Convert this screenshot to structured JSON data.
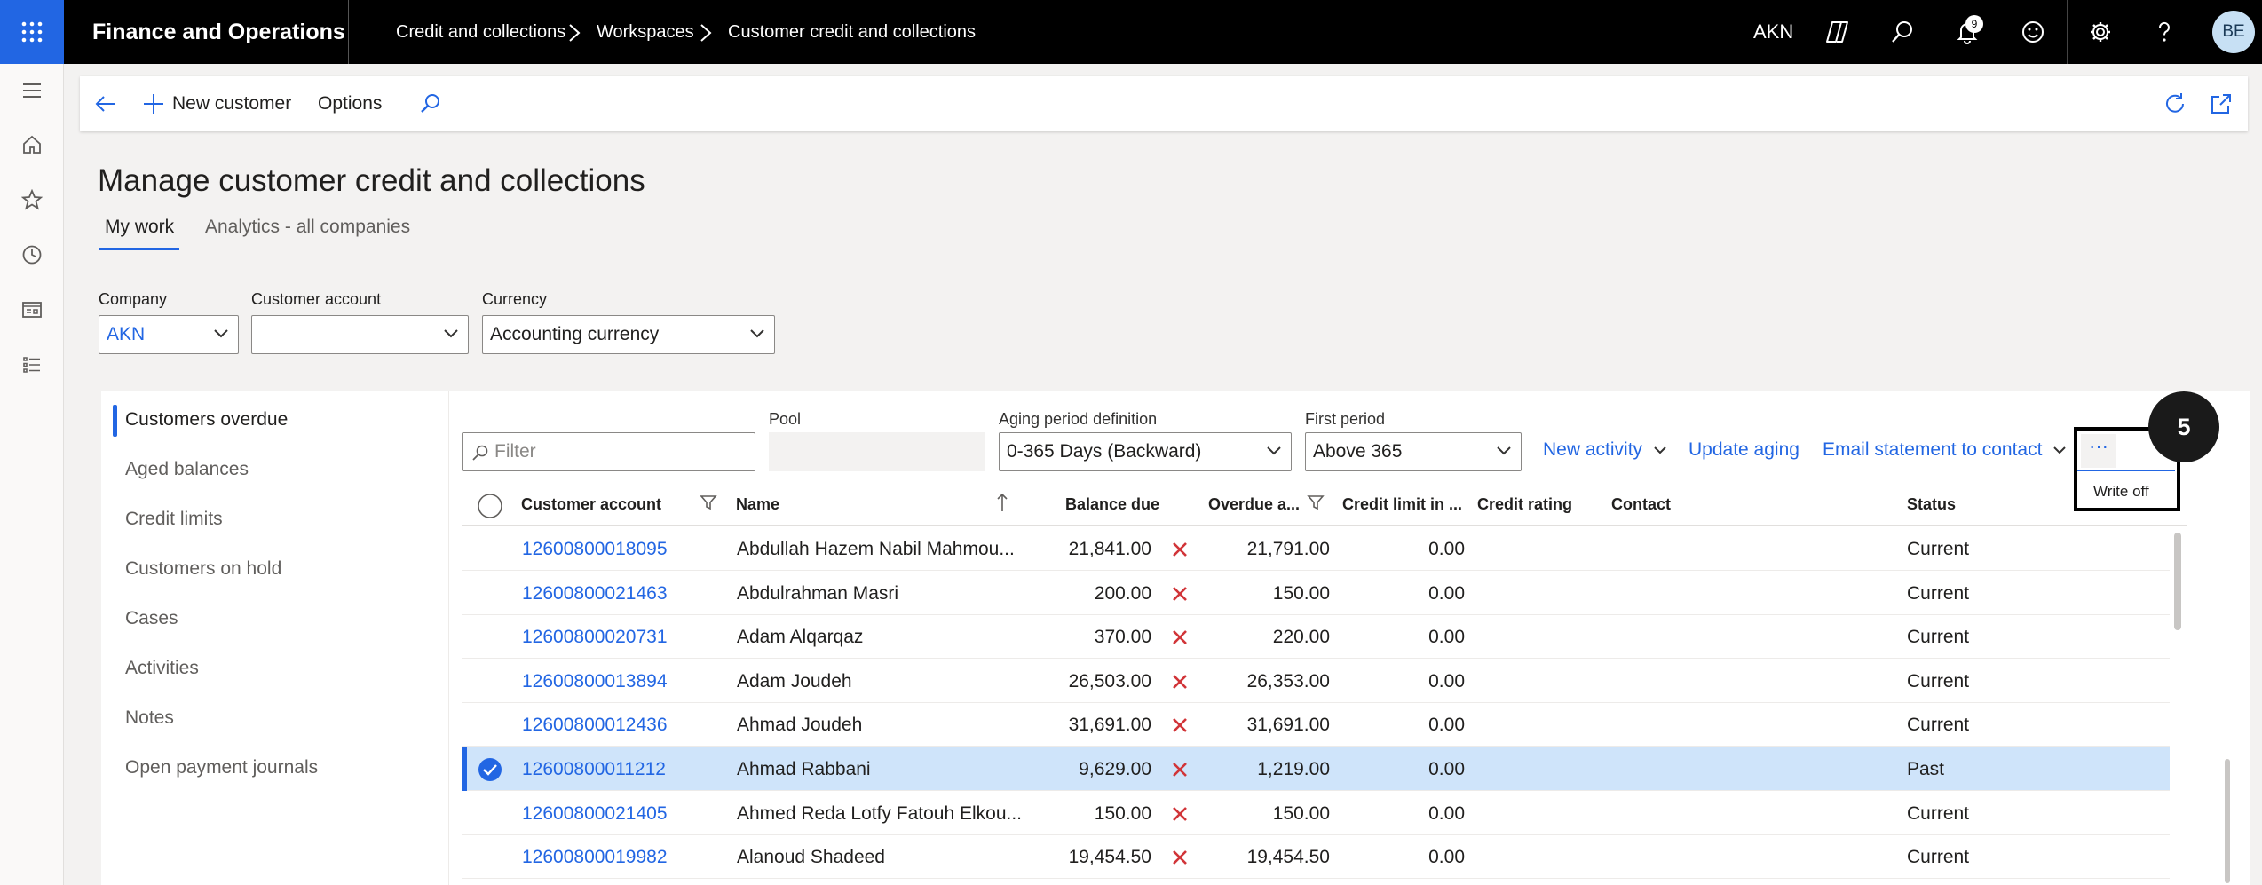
{
  "nav": {
    "app_name": "Finance and Operations",
    "breadcrumb": [
      "Credit and collections",
      "Workspaces",
      "Customer credit and collections"
    ],
    "company_code": "AKN",
    "notification_count": "9",
    "user_initials": "BE"
  },
  "actionbar": {
    "new_customer": "New customer",
    "options": "Options"
  },
  "page": {
    "title": "Manage customer credit and collections",
    "tabs": [
      "My work",
      "Analytics - all companies"
    ]
  },
  "filters": {
    "company_label": "Company",
    "company_value": "AKN",
    "customer_account_label": "Customer account",
    "customer_account_value": "",
    "currency_label": "Currency",
    "currency_value": "Accounting currency"
  },
  "left_nav": [
    "Customers overdue",
    "Aged balances",
    "Credit limits",
    "Customers on hold",
    "Cases",
    "Activities",
    "Notes",
    "Open payment journals"
  ],
  "grid_toolbar": {
    "filter_placeholder": "Filter",
    "pool_label": "Pool",
    "aging_label": "Aging period definition",
    "aging_value": "0-365 Days (Backward)",
    "first_period_label": "First period",
    "first_period_value": "Above 365",
    "new_activity": "New activity",
    "update_aging": "Update aging",
    "email_statement": "Email statement to contact",
    "more_icon": "ellipsis-icon",
    "write_off": "Write off",
    "step_number": "5"
  },
  "grid": {
    "columns": [
      "Customer account",
      "Name",
      "Balance due",
      "Overdue a...",
      "Credit limit in ...",
      "Credit rating",
      "Contact",
      "Status"
    ],
    "rows": [
      {
        "account": "12600800018095",
        "name": "Abdullah Hazem Nabil Mahmou...",
        "balance": "21,841.00",
        "overdue": "21,791.00",
        "credit_limit": "0.00",
        "status": "Current",
        "selected": false
      },
      {
        "account": "12600800021463",
        "name": "Abdulrahman Masri",
        "balance": "200.00",
        "overdue": "150.00",
        "credit_limit": "0.00",
        "status": "Current",
        "selected": false
      },
      {
        "account": "12600800020731",
        "name": "Adam Alqarqaz",
        "balance": "370.00",
        "overdue": "220.00",
        "credit_limit": "0.00",
        "status": "Current",
        "selected": false
      },
      {
        "account": "12600800013894",
        "name": "Adam Joudeh",
        "balance": "26,503.00",
        "overdue": "26,353.00",
        "credit_limit": "0.00",
        "status": "Current",
        "selected": false
      },
      {
        "account": "12600800012436",
        "name": "Ahmad Joudeh",
        "balance": "31,691.00",
        "overdue": "31,691.00",
        "credit_limit": "0.00",
        "status": "Current",
        "selected": false
      },
      {
        "account": "12600800011212",
        "name": "Ahmad Rabbani",
        "balance": "9,629.00",
        "overdue": "1,219.00",
        "credit_limit": "0.00",
        "status": "Past",
        "selected": true
      },
      {
        "account": "12600800021405",
        "name": "Ahmed Reda Lotfy Fatouh Elkou...",
        "balance": "150.00",
        "overdue": "150.00",
        "credit_limit": "0.00",
        "status": "Current",
        "selected": false
      },
      {
        "account": "12600800019982",
        "name": "Alanoud Shadeed",
        "balance": "19,454.50",
        "overdue": "19,454.50",
        "credit_limit": "0.00",
        "status": "Current",
        "selected": false
      }
    ]
  },
  "colors": {
    "accent": "#2266e3",
    "selected_row": "#cfe4fa",
    "overdue_mark": "#d13438"
  }
}
